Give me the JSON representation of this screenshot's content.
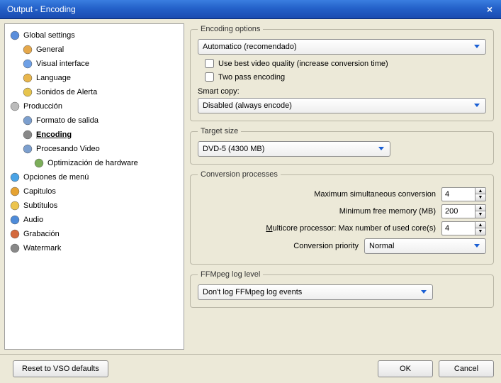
{
  "window": {
    "title": "Output - Encoding"
  },
  "sidebar": {
    "items": [
      {
        "label": "Global settings",
        "icon": "globe",
        "level": 0,
        "sel": false
      },
      {
        "label": "General",
        "icon": "gear",
        "level": 1,
        "sel": false
      },
      {
        "label": "Visual interface",
        "icon": "monitor",
        "level": 1,
        "sel": false
      },
      {
        "label": "Language",
        "icon": "globe2",
        "level": 1,
        "sel": false
      },
      {
        "label": "Sonidos de Alerta",
        "icon": "speaker",
        "level": 1,
        "sel": false
      },
      {
        "label": "Producción",
        "icon": "disc",
        "level": 0,
        "sel": false
      },
      {
        "label": "Formato de salida",
        "icon": "film",
        "level": 1,
        "sel": false
      },
      {
        "label": "Encoding",
        "icon": "gear2",
        "level": 1,
        "sel": true
      },
      {
        "label": "Procesando Video",
        "icon": "video",
        "level": 1,
        "sel": false
      },
      {
        "label": "Optimización de hardware",
        "icon": "chip",
        "level": 2,
        "sel": false
      },
      {
        "label": "Opciones de menú",
        "icon": "menu",
        "level": 0,
        "sel": false
      },
      {
        "label": "Capitulos",
        "icon": "chapters",
        "level": 0,
        "sel": false
      },
      {
        "label": "Subtitulos",
        "icon": "subs",
        "level": 0,
        "sel": false
      },
      {
        "label": "Audio",
        "icon": "audio",
        "level": 0,
        "sel": false
      },
      {
        "label": "Grabación",
        "icon": "burn",
        "level": 0,
        "sel": false
      },
      {
        "label": "Watermark",
        "icon": "watermark",
        "level": 0,
        "sel": false
      }
    ]
  },
  "encoding_options": {
    "legend": "Encoding options",
    "preset": "Automatico (recomendado)",
    "best_quality_checked": false,
    "best_quality_label": "Use best video quality (increase conversion time)",
    "two_pass_checked": false,
    "two_pass_label": "Two pass encoding",
    "smart_copy_label": "Smart copy:",
    "smart_copy_value": "Disabled (always encode)"
  },
  "target_size": {
    "legend": "Target size",
    "value": "DVD-5 (4300 MB)"
  },
  "conversion": {
    "legend": "Conversion processes",
    "max_conv_label": "Maximum simultaneous conversion",
    "max_conv_value": "4",
    "min_mem_label": "Minimum free memory (MB)",
    "min_mem_value": "200",
    "multicore_label": "Multicore processor: Max number of used core(s)",
    "multicore_value": "4",
    "priority_label": "Conversion priority",
    "priority_value": "Normal"
  },
  "ffmpeg": {
    "legend": "FFMpeg log level",
    "value": "Don't log FFMpeg log events"
  },
  "footer": {
    "reset_label": "Reset to VSO defaults",
    "ok_label": "OK",
    "cancel_label": "Cancel"
  }
}
